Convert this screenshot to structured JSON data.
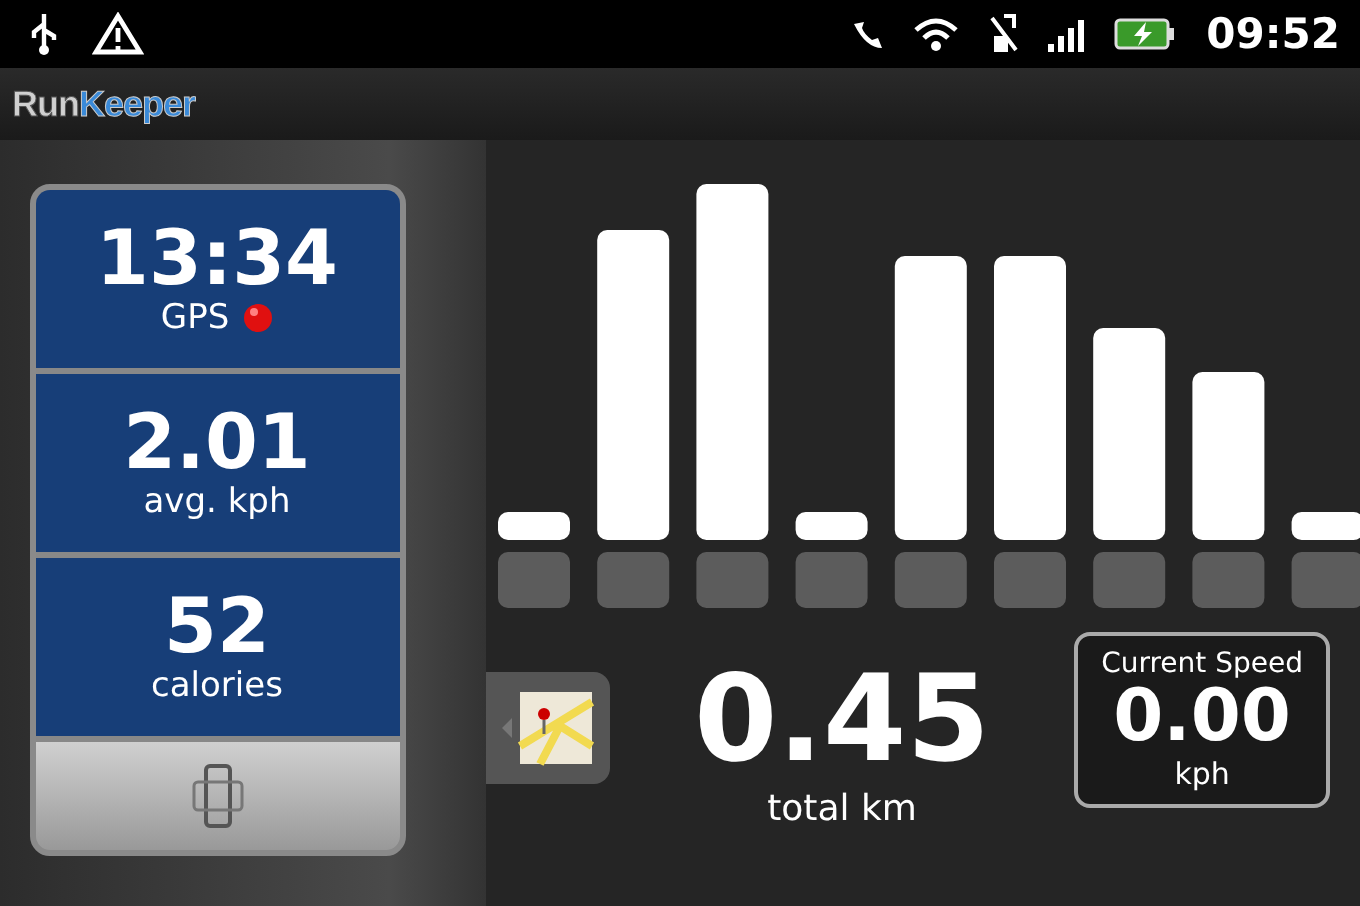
{
  "status_bar": {
    "time": "09:52"
  },
  "app_bar": {
    "logo_first": "Run",
    "logo_second": "Keeper"
  },
  "stats": [
    {
      "value": "13:34",
      "label": "GPS",
      "kind": "gps"
    },
    {
      "value": "2.01",
      "label": "avg. kph",
      "kind": "plain"
    },
    {
      "value": "52",
      "label": "calories",
      "kind": "plain"
    }
  ],
  "distance": {
    "value": "0.45",
    "label": "total km"
  },
  "current_speed": {
    "title": "Current Speed",
    "value": "0.00",
    "unit": "kph"
  }
}
